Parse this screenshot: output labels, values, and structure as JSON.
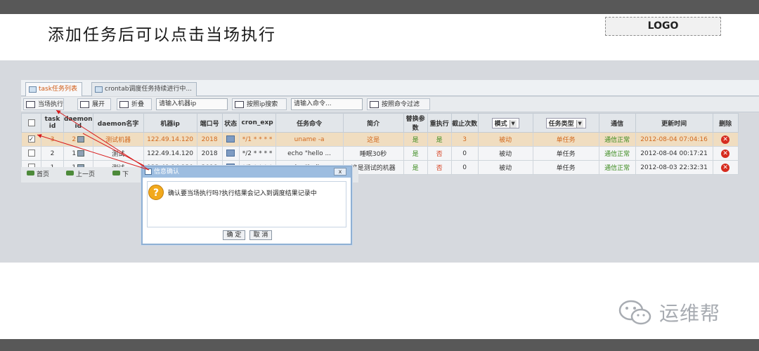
{
  "slide": {
    "title": "添加任务后可以点击当场执行",
    "logo": "LOGO",
    "watermark": "运维帮"
  },
  "tabs": [
    {
      "label": "task任务列表",
      "active": true
    },
    {
      "label": "crontab调度任务持续进行中...",
      "active": false
    }
  ],
  "toolbar": {
    "run_now": "当场执行",
    "expand": "展开",
    "collapse": "折叠",
    "ip_placeholder": "请输入机器ip",
    "ip_search": "按照ip搜索",
    "cmd_placeholder": "请输入命令...",
    "cmd_filter": "按照命令过滤"
  },
  "columns": [
    "task id",
    "daemon id",
    "daemon名字",
    "机器ip",
    "端口号",
    "状态",
    "cron_exp",
    "任务命令",
    "简介",
    "替换参数",
    "重执行",
    "截止次数",
    "模式",
    "",
    "任务类型",
    "",
    "通信",
    "更新时间",
    "删除"
  ],
  "column_combos": {
    "mode": "模式",
    "type": "任务类型"
  },
  "rows": [
    {
      "checked": true,
      "task_id": "3",
      "daemon_id": "2",
      "daemon_name": "测试机器",
      "ip": "122.49.14.120",
      "port": "2018",
      "cron": "*/1 * * * *",
      "cmd": "uname -a",
      "desc": "这是",
      "replace": "是",
      "rerun": "是",
      "limit": "3",
      "mode": "被动",
      "type": "单任务",
      "comm": "通信正常",
      "time": "2012-08-04 07:04:16"
    },
    {
      "checked": false,
      "task_id": "2",
      "daemon_id": "1",
      "daemon_name": "测试",
      "ip": "122.49.14.120",
      "port": "2018",
      "cron": "*/2 * * * *",
      "cmd": "echo \"hello ...",
      "desc": "睡眠30秒",
      "replace": "是",
      "rerun": "否",
      "limit": "0",
      "mode": "被动",
      "type": "单任务",
      "comm": "通信正常",
      "time": "2012-08-04 00:17:21"
    },
    {
      "checked": false,
      "task_id": "1",
      "daemon_id": "1",
      "daemon_name": "测试",
      "ip": "122.49.14.120",
      "port": "2018",
      "cron": "*/2 * * * *",
      "cmd": "echo \"hello ...",
      "desc": "这是测试的机器",
      "replace": "是",
      "rerun": "否",
      "limit": "0",
      "mode": "被动",
      "type": "单任务",
      "comm": "通信正常",
      "time": "2012-08-03 22:32:31"
    }
  ],
  "pager": {
    "first": "首页",
    "prev": "上一页",
    "next": "下"
  },
  "dialog": {
    "title": "信息确认",
    "close": "x",
    "message": "确认要当场执行吗?执行结果会记入到调度结果记录中",
    "ok": "确 定",
    "cancel": "取 消"
  }
}
